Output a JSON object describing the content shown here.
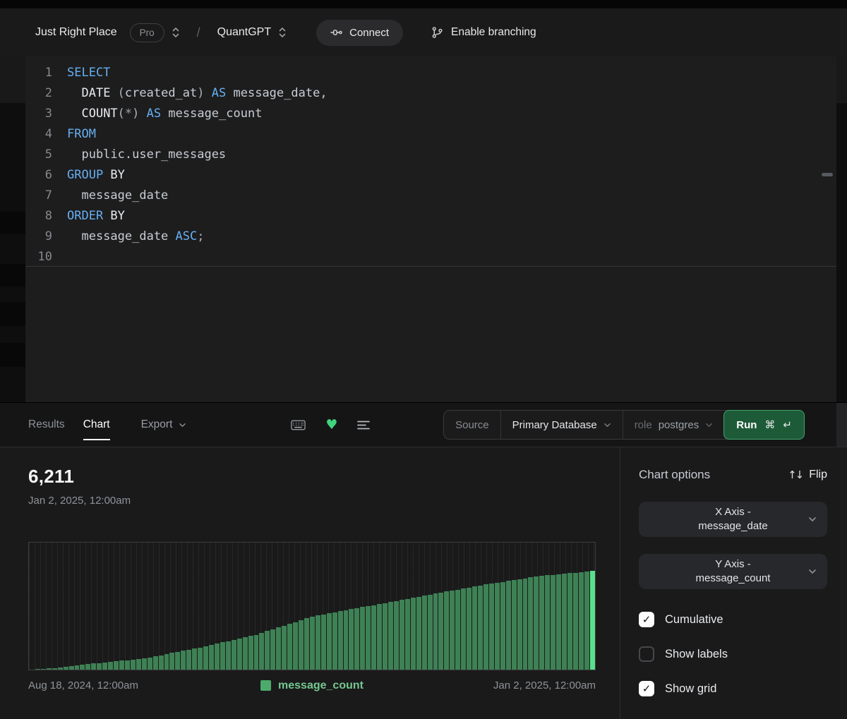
{
  "topbar": {
    "workspace": "Just Right Place",
    "plan_badge": "Pro",
    "separator": "/",
    "project": "QuantGPT",
    "connect_label": "Connect",
    "branching_label": "Enable branching"
  },
  "editor": {
    "active_line": "10",
    "lines": [
      {
        "n": "1",
        "tokens": [
          {
            "t": "SELECT",
            "c": "kw"
          }
        ]
      },
      {
        "n": "2",
        "tokens": [
          {
            "t": "  ",
            "c": "id"
          },
          {
            "t": "DATE ",
            "c": "fn"
          },
          {
            "t": "(",
            "c": "pu"
          },
          {
            "t": "created_at",
            "c": "id"
          },
          {
            "t": ")",
            "c": "pu"
          },
          {
            "t": " ",
            "c": "id"
          },
          {
            "t": "AS",
            "c": "kw"
          },
          {
            "t": " message_date,",
            "c": "id"
          }
        ]
      },
      {
        "n": "3",
        "tokens": [
          {
            "t": "  ",
            "c": "id"
          },
          {
            "t": "COUNT",
            "c": "fn"
          },
          {
            "t": "(",
            "c": "pu"
          },
          {
            "t": "*",
            "c": "op"
          },
          {
            "t": ")",
            "c": "pu"
          },
          {
            "t": " ",
            "c": "id"
          },
          {
            "t": "AS",
            "c": "kw"
          },
          {
            "t": " message_count",
            "c": "id"
          }
        ]
      },
      {
        "n": "4",
        "tokens": [
          {
            "t": "FROM",
            "c": "kw"
          }
        ]
      },
      {
        "n": "5",
        "tokens": [
          {
            "t": "  public.user_messages",
            "c": "id"
          }
        ]
      },
      {
        "n": "6",
        "tokens": [
          {
            "t": "GROUP",
            "c": "kw"
          },
          {
            "t": " BY",
            "c": "fn"
          }
        ]
      },
      {
        "n": "7",
        "tokens": [
          {
            "t": "  message_date",
            "c": "id"
          }
        ]
      },
      {
        "n": "8",
        "tokens": [
          {
            "t": "ORDER",
            "c": "kw"
          },
          {
            "t": " BY",
            "c": "fn"
          }
        ]
      },
      {
        "n": "9",
        "tokens": [
          {
            "t": "  message_date ",
            "c": "id"
          },
          {
            "t": "ASC",
            "c": "kw"
          },
          {
            "t": ";",
            "c": "pu"
          }
        ]
      },
      {
        "n": "10",
        "tokens": []
      }
    ]
  },
  "toolbar": {
    "tabs": [
      {
        "label": "Results",
        "active": false
      },
      {
        "label": "Chart",
        "active": true
      }
    ],
    "export_label": "Export",
    "source_label": "Source",
    "database": "Primary Database",
    "role_label": "role",
    "role_value": "postgres",
    "run_label": "Run",
    "run_cmd_glyph": "⌘",
    "run_enter_glyph": "↵"
  },
  "chart": {
    "header_value": "6,211",
    "header_date": "Jan 2, 2025, 12:00am",
    "x_left_label": "Aug 18, 2024, 12:00am",
    "x_right_label": "Jan 2, 2025, 12:00am",
    "legend_label": "message_count"
  },
  "chart_data": {
    "type": "bar",
    "title": "",
    "xlabel": "message_date",
    "ylabel": "message_count",
    "series_name": "message_count",
    "cumulative": true,
    "grid": "vertical",
    "legend_position": "bottom-center",
    "x_start_label": "Aug 18, 2024, 12:00am",
    "x_end_label": "Jan 2, 2025, 12:00am",
    "latest_value": 6211,
    "latest_label": "Jan 2, 2025, 12:00am",
    "ylim": [
      0,
      8000
    ],
    "values": [
      0,
      24,
      48,
      72,
      96,
      120,
      166,
      212,
      258,
      304,
      350,
      385,
      420,
      455,
      490,
      525,
      560,
      595,
      630,
      665,
      700,
      770,
      840,
      910,
      980,
      1050,
      1120,
      1190,
      1260,
      1330,
      1400,
      1480,
      1560,
      1640,
      1720,
      1800,
      1880,
      1960,
      2040,
      2120,
      2200,
      2314,
      2428,
      2542,
      2656,
      2770,
      2884,
      2998,
      3112,
      3226,
      3340,
      3406,
      3472,
      3538,
      3604,
      3670,
      3736,
      3802,
      3868,
      3934,
      4000,
      4066,
      4132,
      4198,
      4264,
      4330,
      4396,
      4462,
      4528,
      4594,
      4660,
      4724,
      4788,
      4852,
      4916,
      4980,
      5044,
      5108,
      5172,
      5236,
      5300,
      5357,
      5414,
      5471,
      5528,
      5585,
      5642,
      5699,
      5756,
      5813,
      5870,
      5904,
      5938,
      5972,
      6006,
      6040,
      6074,
      6108,
      6142,
      6176,
      6211
    ]
  },
  "options": {
    "title": "Chart options",
    "flip_label": "Flip",
    "x_axis": {
      "line1": "X Axis -",
      "line2": "message_date"
    },
    "y_axis": {
      "line1": "Y Axis -",
      "line2": "message_count"
    },
    "checkboxes": [
      {
        "label": "Cumulative",
        "checked": true
      },
      {
        "label": "Show labels",
        "checked": false
      },
      {
        "label": "Show grid",
        "checked": true
      }
    ]
  },
  "colors": {
    "accent_green": "#41d47e",
    "bar_green": "#3e8155",
    "bar_highlight": "#58e08a",
    "keyword_blue": "#66aff0",
    "run_button_green": "#1d5b38"
  }
}
